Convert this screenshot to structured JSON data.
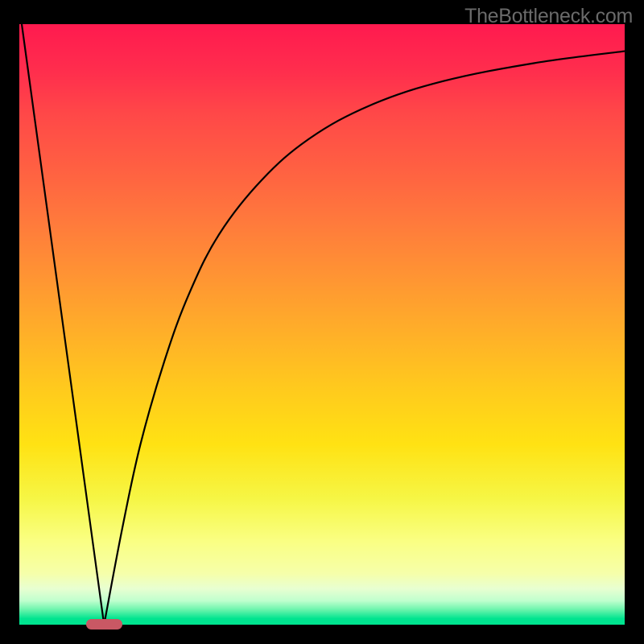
{
  "watermark": "TheBottleneck.com",
  "chart_data": {
    "type": "line",
    "title": "",
    "xlabel": "",
    "ylabel": "",
    "xlim": [
      0,
      100
    ],
    "ylim": [
      0,
      100
    ],
    "background_gradient": {
      "top": "#ff1a4f",
      "bottom": "#00e48f",
      "via": [
        "#ff7a3c",
        "#ffe213",
        "#faff82"
      ]
    },
    "optimum_x": 14,
    "series": [
      {
        "name": "left-branch",
        "description": "steep linear drop from top-left to optimum",
        "points": [
          {
            "x": 0.4,
            "y": 100
          },
          {
            "x": 14,
            "y": 0
          }
        ]
      },
      {
        "name": "right-branch",
        "description": "saturating rise from optimum toward upper-right",
        "points": [
          {
            "x": 14,
            "y": 0
          },
          {
            "x": 17,
            "y": 16
          },
          {
            "x": 20,
            "y": 30
          },
          {
            "x": 24,
            "y": 44
          },
          {
            "x": 28,
            "y": 55
          },
          {
            "x": 33,
            "y": 65
          },
          {
            "x": 40,
            "y": 74
          },
          {
            "x": 48,
            "y": 81
          },
          {
            "x": 58,
            "y": 86.5
          },
          {
            "x": 70,
            "y": 90.5
          },
          {
            "x": 85,
            "y": 93.5
          },
          {
            "x": 100,
            "y": 95.5
          }
        ]
      }
    ],
    "marker": {
      "x_center": 14,
      "width_pct": 6,
      "color": "#c95864",
      "shape": "rounded-bar"
    }
  }
}
